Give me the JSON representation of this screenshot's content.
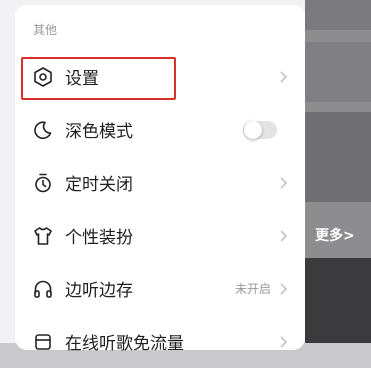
{
  "section": {
    "title": "其他"
  },
  "items": [
    {
      "label": "设置",
      "icon": "hexagon-settings-icon"
    },
    {
      "label": "深色模式",
      "icon": "moon-icon"
    },
    {
      "label": "定时关闭",
      "icon": "timer-icon"
    },
    {
      "label": "个性装扮",
      "icon": "tshirt-icon"
    },
    {
      "label": "边听边存",
      "icon": "headphones-icon",
      "value": "未开启"
    },
    {
      "label": "在线听歌免流量",
      "icon": "sim-card-icon"
    }
  ],
  "background": {
    "more_label": "更多>"
  },
  "colors": {
    "highlight": "#d9302a",
    "text": "#1f1f1f",
    "muted": "#9a9a9a"
  }
}
